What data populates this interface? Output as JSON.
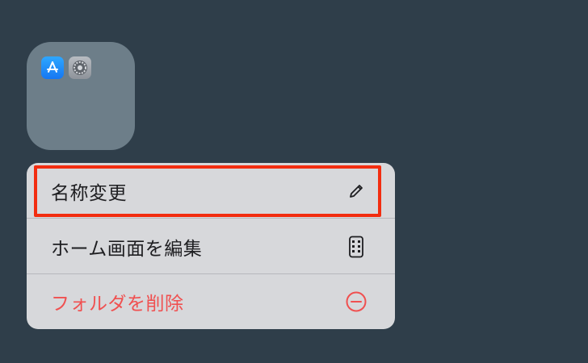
{
  "folder": {
    "apps": [
      {
        "icon": "app-store-icon",
        "color": "#1a8cff"
      },
      {
        "icon": "settings-gear-icon",
        "color": "#9a9ea4"
      }
    ]
  },
  "menu": {
    "items": [
      {
        "label": "名称変更",
        "icon": "pencil-icon"
      },
      {
        "label": "ホーム画面を編集",
        "icon": "phone-screen-icon"
      },
      {
        "label": "フォルダを削除",
        "icon": "minus-circle-icon",
        "color": "#f05050"
      }
    ]
  },
  "highlight_color": "#f22d10"
}
